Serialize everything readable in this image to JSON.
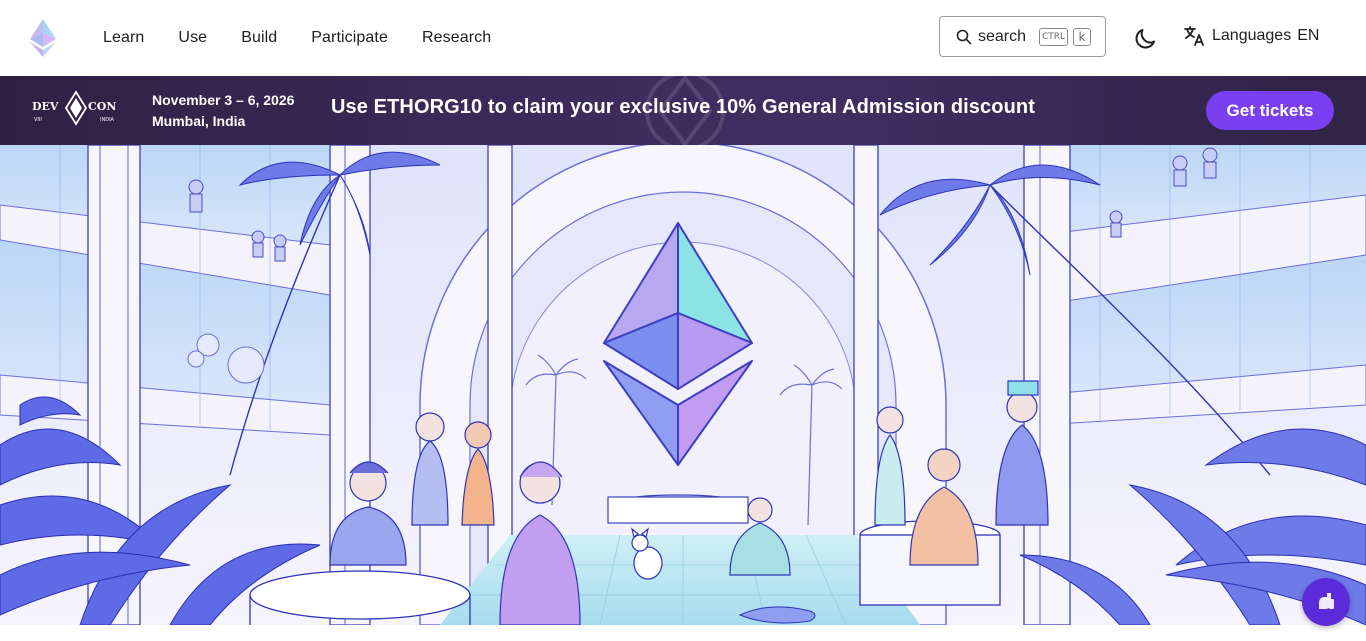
{
  "nav": {
    "links": [
      "Learn",
      "Use",
      "Build",
      "Participate",
      "Research"
    ],
    "search": {
      "label": "search",
      "shortcut_ctrl": "CTRL",
      "shortcut_key": "k"
    },
    "language": {
      "label": "Languages",
      "code": "EN"
    }
  },
  "banner": {
    "event_logo": "DEVCON VIII INDIA",
    "date": "November 3 – 6, 2026",
    "location": "Mumbai, India",
    "promo": "Use ETHORG10 to claim your exclusive 10% General Admission discount",
    "cta": "Get tickets"
  },
  "colors": {
    "banner_bg": "#3a2a58",
    "cta_bg": "#7b3ff2",
    "chat_button": "#5b2bd9"
  },
  "hero": {
    "illustration": "ethereum-community-atrium"
  },
  "chat": {
    "icon": "chat-icon"
  }
}
